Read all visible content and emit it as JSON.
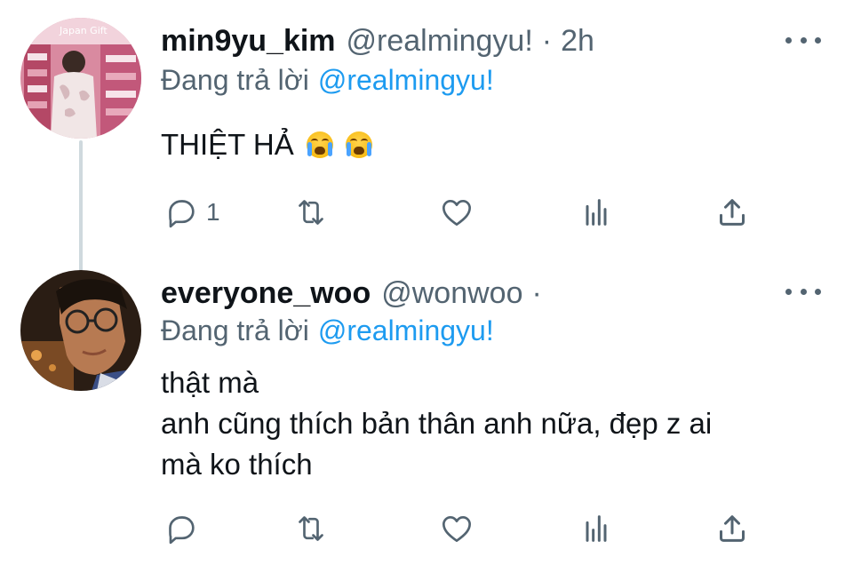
{
  "tweets": [
    {
      "display_name": "min9yu_kim",
      "handle": "@realmingyu!",
      "separator": "·",
      "time": "2h",
      "reply_prefix": "Đang trả lời",
      "reply_to": "@realmingyu!",
      "text": "THIỆT HẢ",
      "emoji": [
        "loudly-crying-face",
        "loudly-crying-face"
      ],
      "reply_count": "1",
      "retweet_count": "",
      "like_count": "",
      "avatar_colors": [
        "#c45a78",
        "#e9b7c4",
        "#8e2f4f"
      ]
    },
    {
      "display_name": "everyone_woo",
      "handle": "@wonwoo",
      "separator": "·",
      "time": "",
      "reply_prefix": "Đang trả lời",
      "reply_to": "@realmingyu!",
      "text_lines": [
        "thật mà",
        "anh cũng thích bản thân anh nữa, đẹp z ai",
        "mà ko thích"
      ],
      "reply_count": "",
      "retweet_count": "",
      "like_count": "",
      "avatar_colors": [
        "#2b1f16",
        "#a36b3f",
        "#3a4c7a"
      ]
    }
  ],
  "icons": {
    "reply": "speech-bubble-icon",
    "retweet": "retweet-arrows-icon",
    "like": "heart-icon",
    "views": "bar-chart-icon",
    "share": "share-upload-icon",
    "more": "more-dots-icon"
  },
  "colors": {
    "text": "#0f1419",
    "secondary": "#536471",
    "link": "#1d9bf0",
    "thread_line": "#cfd9de"
  }
}
